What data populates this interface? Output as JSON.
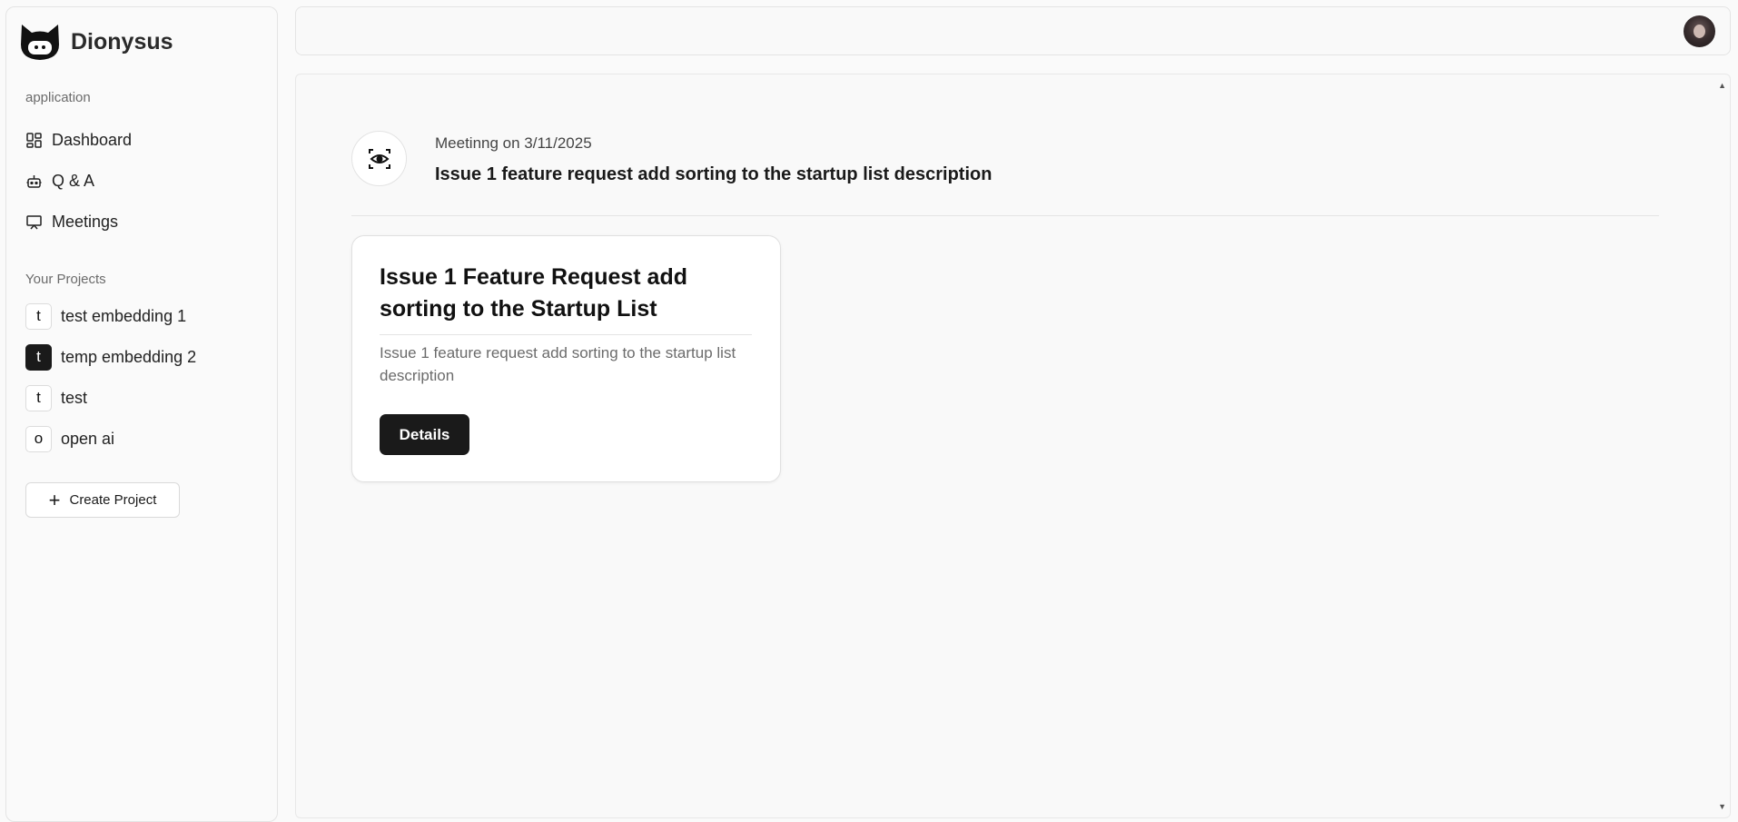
{
  "app": {
    "name": "Dionysus",
    "logo_icon": "cat-face-logo-icon"
  },
  "sidebar": {
    "application_label": "application",
    "nav": [
      {
        "label": "Dashboard",
        "icon": "dashboard-icon"
      },
      {
        "label": "Q & A",
        "icon": "robot-icon"
      },
      {
        "label": "Meetings",
        "icon": "presentation-icon"
      }
    ],
    "projects_label": "Your Projects",
    "projects": [
      {
        "badge": "t",
        "label": "test embedding 1",
        "active": false
      },
      {
        "badge": "t",
        "label": "temp embedding 2",
        "active": true
      },
      {
        "badge": "t",
        "label": "test",
        "active": false
      },
      {
        "badge": "o",
        "label": "open ai",
        "active": false
      }
    ],
    "create_project_label": "Create Project"
  },
  "meeting": {
    "date_label": "Meetinng on 3/11/2025",
    "title": "Issue 1 feature request add sorting to the startup list description",
    "icon": "eye-scan-icon"
  },
  "issues": [
    {
      "title": "Issue 1 Feature Request add sorting to the Startup List",
      "description": "Issue 1 feature request add sorting to the startup list description",
      "button_label": "Details"
    }
  ],
  "colors": {
    "accent_dark": "#1a1a1a",
    "background": "#fafafa",
    "muted_text": "#6b6b6b"
  }
}
